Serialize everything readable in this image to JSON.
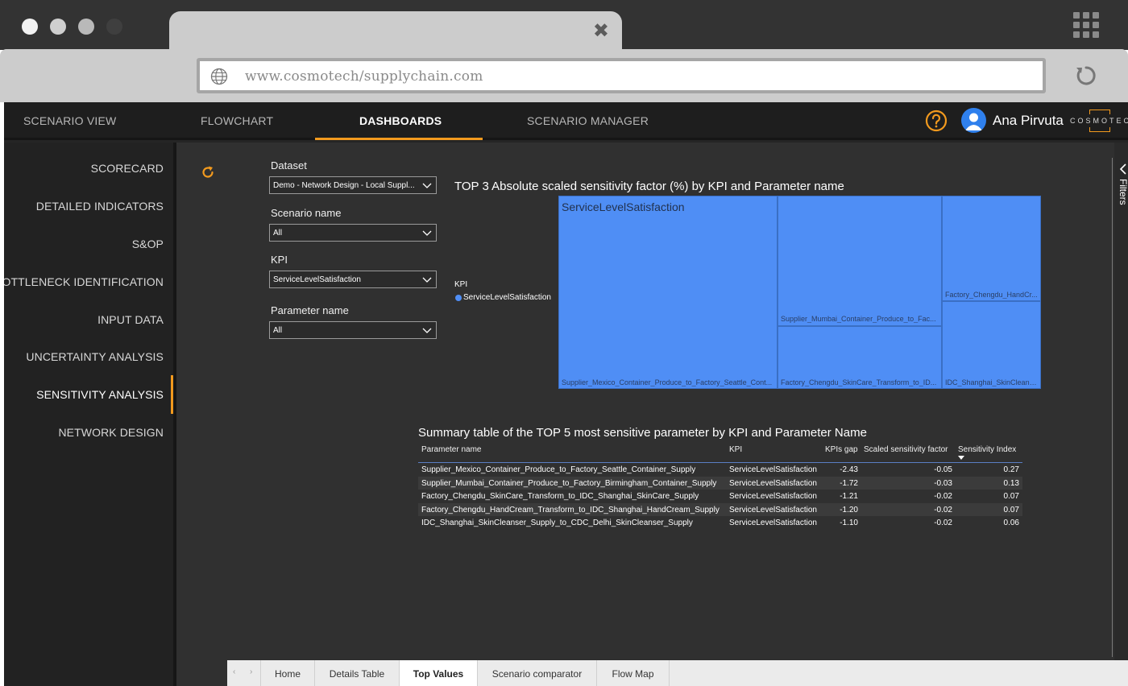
{
  "browser": {
    "url": "www.cosmotech/supplychain.com",
    "dot_colors": [
      "#f2f2f2",
      "#cfcfcf",
      "#b9b9b9",
      "#3f3f3f"
    ]
  },
  "topnav": {
    "items": [
      "SCENARIO VIEW",
      "FLOWCHART",
      "DASHBOARDS",
      "SCENARIO MANAGER"
    ],
    "active": "DASHBOARDS",
    "user_name": "Ana Pirvuta",
    "logo_text": "COSMOTECH"
  },
  "sidebar": {
    "items": [
      "SCORECARD",
      "DETAILED INDICATORS",
      "S&OP",
      "BOTTLENECK IDENTIFICATION",
      "INPUT DATA",
      "UNCERTAINTY ANALYSIS",
      "SENSITIVITY ANALYSIS",
      "NETWORK DESIGN"
    ],
    "active": "SENSITIVITY ANALYSIS"
  },
  "slicers": [
    {
      "label": "Dataset",
      "value": "Demo - Network Design - Local Suppl..."
    },
    {
      "label": "Scenario name",
      "value": "All"
    },
    {
      "label": "KPI",
      "value": "ServiceLevelSatisfaction"
    },
    {
      "label": "Parameter name",
      "value": "All"
    }
  ],
  "treemap": {
    "title": "TOP 3 Absolute scaled sensitivity factor (%) by KPI and Parameter name",
    "legend_title": "KPI",
    "legend_item": "ServiceLevelSatisfaction",
    "accent": "#4f8ef5",
    "group": "ServiceLevelSatisfaction",
    "tiles": [
      "Supplier_Mexico_Container_Produce_to_Factory_Seattle_Cont...",
      "Supplier_Mumbai_Container_Produce_to_Fac...",
      "Factory_Chengdu_SkinCare_Transform_to_ID...",
      "Factory_Chengdu_HandCr...",
      "IDC_Shanghai_SkinCleans..."
    ]
  },
  "table": {
    "title": "Summary table of the TOP 5 most sensitive parameter by KPI and Parameter Name",
    "columns": [
      "Parameter name",
      "KPI",
      "KPIs gap",
      "Scaled sensitivity factor",
      "Sensitivity Index"
    ],
    "rows": [
      [
        "Supplier_Mexico_Container_Produce_to_Factory_Seattle_Container_Supply",
        "ServiceLevelSatisfaction",
        "-2.43",
        "-0.05",
        "0.27"
      ],
      [
        "Supplier_Mumbai_Container_Produce_to_Factory_Birmingham_Container_Supply",
        "ServiceLevelSatisfaction",
        "-1.72",
        "-0.03",
        "0.13"
      ],
      [
        "Factory_Chengdu_SkinCare_Transform_to_IDC_Shanghai_SkinCare_Supply",
        "ServiceLevelSatisfaction",
        "-1.21",
        "-0.02",
        "0.07"
      ],
      [
        "Factory_Chengdu_HandCream_Transform_to_IDC_Shanghai_HandCream_Supply",
        "ServiceLevelSatisfaction",
        "-1.20",
        "-0.02",
        "0.07"
      ],
      [
        "IDC_Shanghai_SkinCleanser_Supply_to_CDC_Delhi_SkinCleanser_Supply",
        "ServiceLevelSatisfaction",
        "-1.10",
        "-0.02",
        "0.06"
      ]
    ]
  },
  "filters_label": "Filters",
  "page_tabs": {
    "items": [
      "Home",
      "Details Table",
      "Top Values",
      "Scenario comparator",
      "Flow Map"
    ],
    "active": "Top Values"
  },
  "colors": {
    "accent_orange": "#f29a1e",
    "app_bg": "#252525",
    "report_bg": "#303030"
  }
}
